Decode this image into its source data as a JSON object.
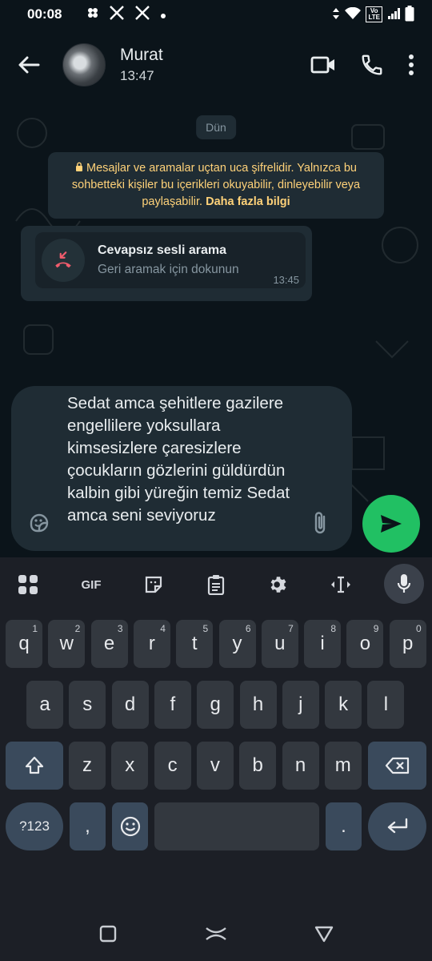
{
  "status_bar": {
    "time": "00:08",
    "left_icons": [
      "fan-icon",
      "x-app-icon",
      "x-app-icon",
      "dot-icon"
    ],
    "right_icons": [
      "data-arrows-icon",
      "wifi-icon",
      "volte-icon",
      "signal-icon",
      "battery-icon"
    ],
    "volte_line1": "Vo",
    "volte_line2": "LTE"
  },
  "header": {
    "contact_name": "Murat",
    "contact_status": "13:47"
  },
  "chat": {
    "date_chip": "Dün",
    "e2e_notice": "Mesajlar ve aramalar uçtan uca şifrelidir. Yalnızca bu sohbetteki kişiler bu içerikleri okuyabilir, dinleyebilir veya paylaşabilir.",
    "e2e_learn_more": "Daha fazla bilgi",
    "missed_call": {
      "title": "Cevapsız sesli arama",
      "subtitle": "Geri aramak için dokunun",
      "time": "13:45"
    }
  },
  "composer": {
    "text": "Sedat amca şehitlere gazilere engellilere yoksullara kimsesizlere çaresizlere çocukların gözlerini güldürdün kalbin gibi yüreğin temiz Sedat amca seni seviyoruz"
  },
  "keyboard": {
    "toolbar": {
      "gif_label": "GIF"
    },
    "row1": [
      {
        "key": "q",
        "hint": "1"
      },
      {
        "key": "w",
        "hint": "2"
      },
      {
        "key": "e",
        "hint": "3"
      },
      {
        "key": "r",
        "hint": "4"
      },
      {
        "key": "t",
        "hint": "5"
      },
      {
        "key": "y",
        "hint": "6"
      },
      {
        "key": "u",
        "hint": "7"
      },
      {
        "key": "i",
        "hint": "8"
      },
      {
        "key": "o",
        "hint": "9"
      },
      {
        "key": "p",
        "hint": "0"
      }
    ],
    "row2": [
      "a",
      "s",
      "d",
      "f",
      "g",
      "h",
      "j",
      "k",
      "l"
    ],
    "row3": [
      "z",
      "x",
      "c",
      "v",
      "b",
      "n",
      "m"
    ],
    "symbols_label": "?123",
    "comma_label": ",",
    "period_label": "."
  },
  "colors": {
    "accent_green": "#21c063",
    "missed_red": "#f15c6d",
    "notice_yellow": "#ffd279"
  }
}
